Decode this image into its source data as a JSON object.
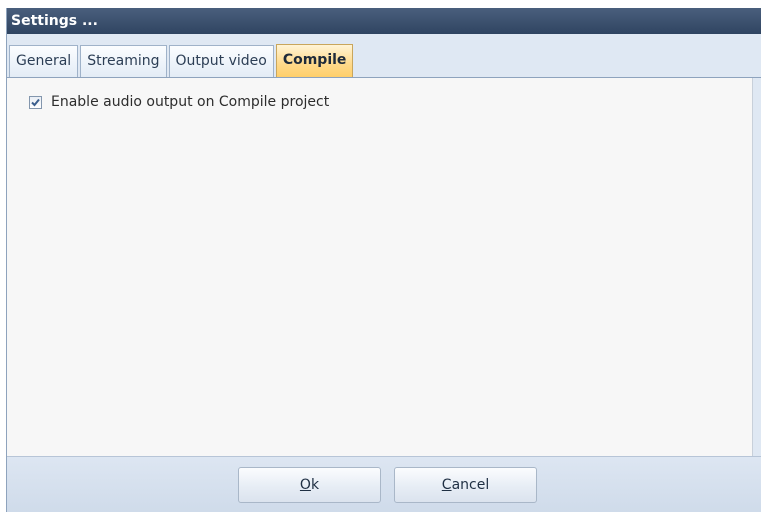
{
  "window": {
    "title": "Settings ..."
  },
  "tabs": [
    {
      "label": "General",
      "active": false
    },
    {
      "label": "Streaming",
      "active": false
    },
    {
      "label": "Output video",
      "active": false
    },
    {
      "label": "Compile",
      "active": true
    }
  ],
  "compile": {
    "enable_audio_label": "Enable audio output on Compile project",
    "enable_audio_checked": true
  },
  "buttons": {
    "ok": {
      "mnemonic": "O",
      "rest": "k"
    },
    "cancel": {
      "mnemonic": "C",
      "rest": "ancel"
    }
  },
  "colors": {
    "title_bar": "#2f4461",
    "active_tab": "#ffd98a",
    "frame": "#dfe8f3"
  },
  "icons": {
    "checkbox_mark": "check-icon"
  }
}
